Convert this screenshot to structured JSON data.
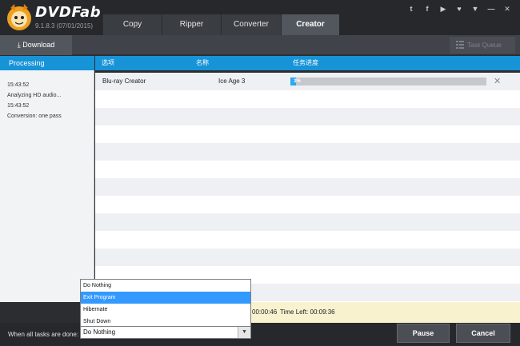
{
  "app": {
    "name": "DVDFab",
    "version": "9.1.8.3 (07/01/2015)"
  },
  "tabs": [
    {
      "label": "Copy",
      "active": false
    },
    {
      "label": "Ripper",
      "active": false
    },
    {
      "label": "Converter",
      "active": false
    },
    {
      "label": "Creator",
      "active": true
    }
  ],
  "social": [
    "twitter-icon",
    "facebook-icon",
    "youtube-icon",
    "heart-icon",
    "dropdown-icon",
    "minimize-icon",
    "close-icon"
  ],
  "social_text": [
    "t",
    "f",
    "▶",
    "♥",
    "▼",
    "—",
    "✕"
  ],
  "toolbar": {
    "download_label": "Download",
    "task_queue_label": "Task Queue"
  },
  "side": {
    "header": "Processing",
    "log": [
      "15:43:52",
      "Analyzing HD audio...",
      "15:43:52",
      "Conversion: one pass"
    ]
  },
  "table": {
    "headers": [
      "选项",
      "名称",
      "任务进度"
    ],
    "rows": [
      {
        "option": "Blu-ray Creator",
        "name": "Ice Age 3",
        "progress_percent": 3,
        "progress_label": "3%"
      }
    ]
  },
  "status": {
    "elapsed_fragment": "00:00:46",
    "time_left": "Time Left: 00:09:36"
  },
  "footer": {
    "when_done_label": "When all tasks are done:",
    "selected_value": "Do Nothing",
    "options": [
      "Do Nothing",
      "Exit Program",
      "Hibernate",
      "Shut Down"
    ],
    "highlighted_option": "Exit Program",
    "pause_label": "Pause",
    "cancel_label": "Cancel"
  },
  "colors": {
    "accent": "#1793d8",
    "progress": "#29a8f0",
    "status_bg": "#f8f2cf"
  }
}
